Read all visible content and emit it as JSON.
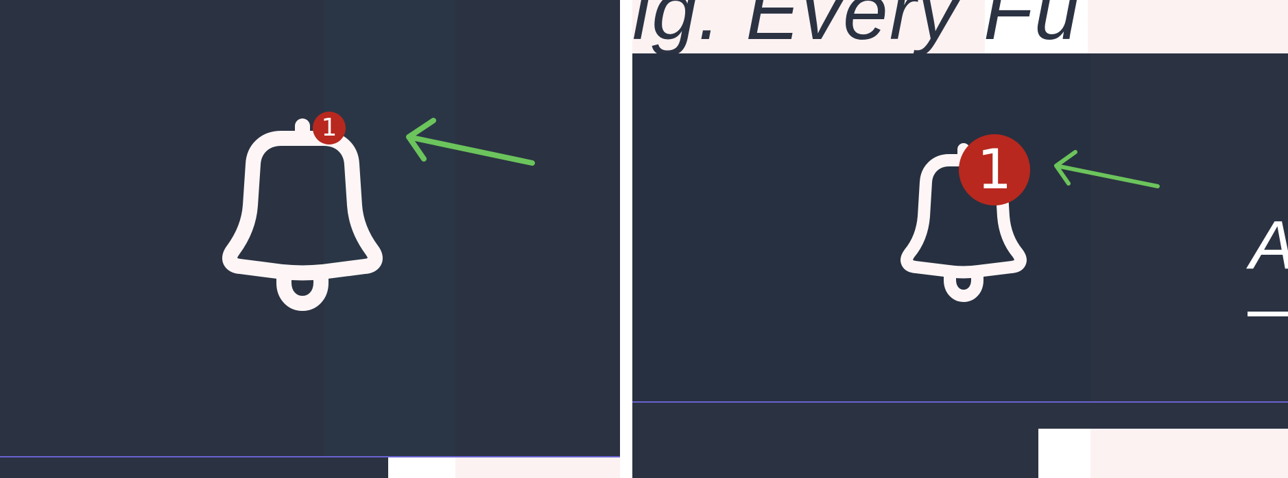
{
  "colors": {
    "background_dark": "#2b3242",
    "icon_white": "#fef6f6",
    "badge_red": "#b8281e",
    "arrow_green": "#6cc45c",
    "accent_line": "#6a63d2",
    "pink_strip": "#fdf2f2"
  },
  "left_panel": {
    "notification_icon": "bell-icon",
    "badge_count": "1",
    "arrow_icon": "arrow-left-icon"
  },
  "right_panel": {
    "heading_fragment": "ig. Every Fu",
    "notification_icon": "bell-icon",
    "badge_count": "1",
    "arrow_icon": "arrow-left-icon",
    "link_fragment": "A"
  }
}
